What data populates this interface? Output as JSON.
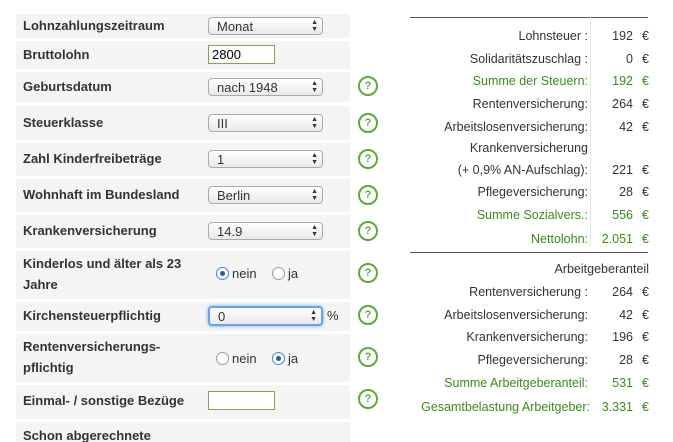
{
  "form": {
    "rows": [
      {
        "label": "Lohnzahlungszeitraum",
        "value": "Monat"
      },
      {
        "label": "Bruttolohn",
        "value": "2800"
      },
      {
        "label": "Geburtsdatum",
        "value": "nach 1948"
      },
      {
        "label": "Steuerklasse",
        "value": "III"
      },
      {
        "label": "Zahl Kinderfreibeträge",
        "value": "1"
      },
      {
        "label": "Wohnhaft im Bundesland",
        "value": "Berlin"
      },
      {
        "label": "Krankenversicherung",
        "value": "14.9"
      },
      {
        "label_line1": "Kinderlos und älter als 23",
        "label_line2": "Jahre",
        "opt_no": "nein",
        "opt_yes": "ja",
        "selected": "nein"
      },
      {
        "label": "Kirchensteuerpflichtig",
        "value": "0",
        "unit": "%"
      },
      {
        "label_line1": "Rentenversicherungs-",
        "label_line2": "pflichtig",
        "opt_no": "nein",
        "opt_yes": "ja",
        "selected": "ja"
      },
      {
        "label": "Einmal- / sonstige Bezüge",
        "value": ""
      },
      {
        "label": "Schon abgerechnete"
      }
    ],
    "help_icon_glyph": "?",
    "help_icon_color": "#5fa839"
  },
  "results": {
    "employee": [
      {
        "label": "Lohnsteuer :",
        "value": "192",
        "currency": "€"
      },
      {
        "label": "Solidaritätszuschlag :",
        "value": "0",
        "currency": "€"
      },
      {
        "label": "Summe der Steuern:",
        "value": "192",
        "currency": "€",
        "highlight": true
      },
      {
        "label": "Rentenversicherung:",
        "value": "264",
        "currency": "€"
      },
      {
        "label": "Arbeitslosenversicherung:",
        "value": "42",
        "currency": "€"
      },
      {
        "label_line1": "Krankenversicherung",
        "label": "(+ 0,9% AN-Aufschlag):",
        "value": "221",
        "currency": "€"
      },
      {
        "label": "Pflegeversicherung:",
        "value": "28",
        "currency": "€"
      },
      {
        "label": "Summe Sozialvers.:",
        "value": "556",
        "currency": "€",
        "highlight": true
      },
      {
        "label": "Nettolohn:",
        "value": "2.051",
        "currency": "€",
        "highlight": true
      }
    ],
    "employer_title": "Arbeitgeberanteil",
    "employer": [
      {
        "label": "Rentenversicherung :",
        "value": "264",
        "currency": "€"
      },
      {
        "label": "Arbeitslosenversicherung:",
        "value": "42",
        "currency": "€"
      },
      {
        "label": "Krankenversicherung:",
        "value": "196",
        "currency": "€"
      },
      {
        "label": "Pflegeversicherung:",
        "value": "28",
        "currency": "€"
      },
      {
        "label": "Summe Arbeitgeberanteil:",
        "value": "531",
        "currency": "€",
        "highlight": true
      },
      {
        "label": "Gesamtbelastung Arbeitgeber:",
        "value": "3.331",
        "currency": "€",
        "highlight": true
      }
    ],
    "highlight_color": "#3c8a1e"
  }
}
